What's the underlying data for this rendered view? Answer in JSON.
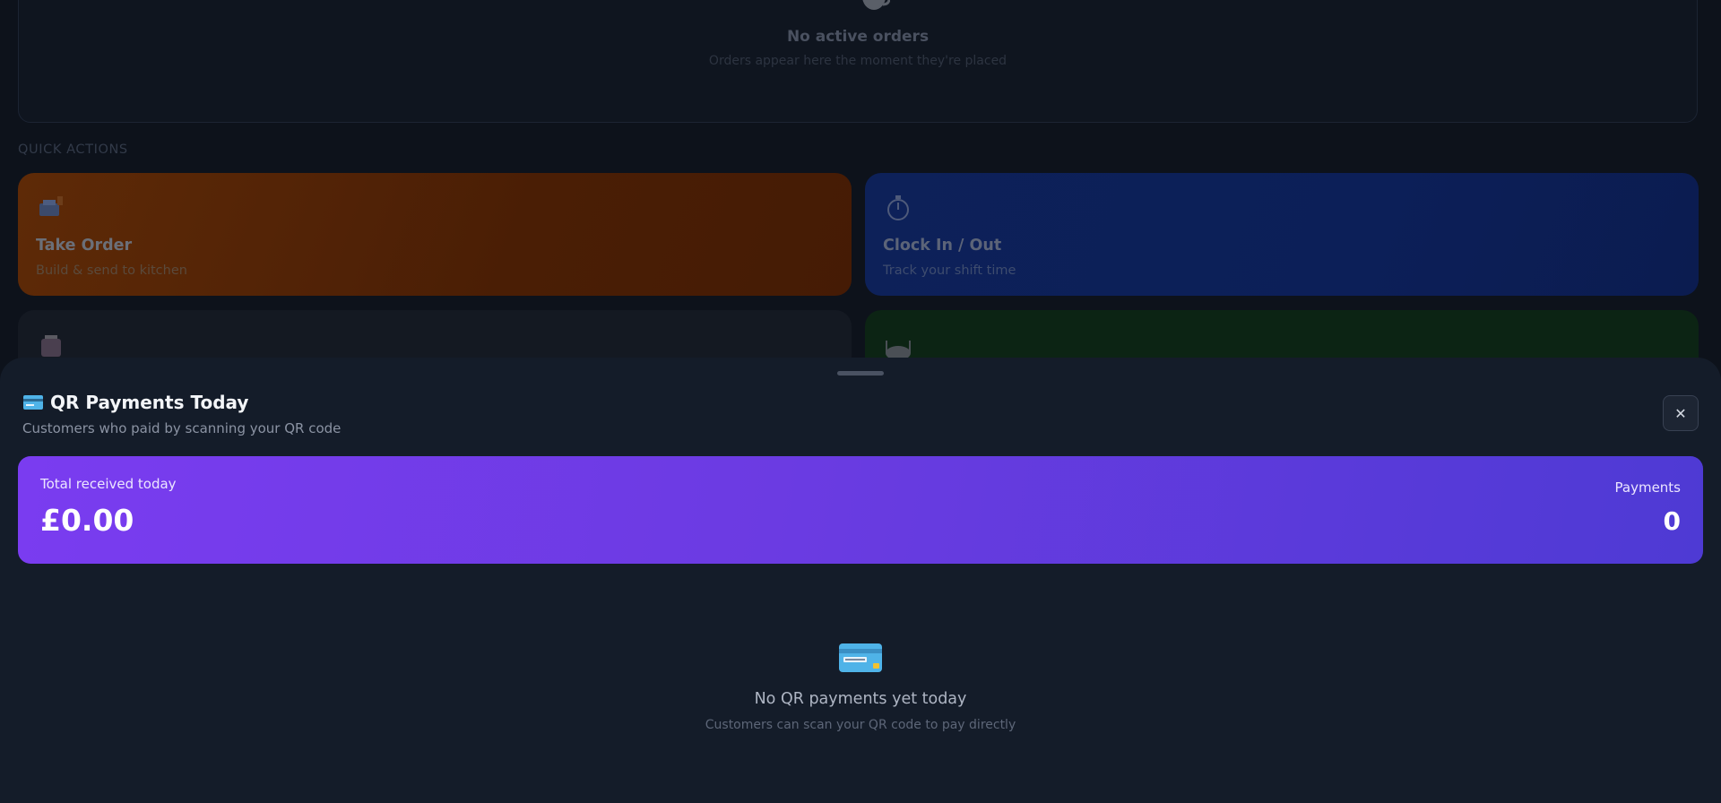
{
  "orders": {
    "icon": "coffee-icon",
    "empty_title": "No active orders",
    "empty_subtitle": "Orders appear here the moment they're placed"
  },
  "quick_actions": {
    "label": "QUICK ACTIONS",
    "items": [
      {
        "title": "Take Order",
        "subtitle": "Build & send to kitchen",
        "icon": "cash-register-icon",
        "color": "#c2410c"
      },
      {
        "title": "Clock In / Out",
        "subtitle": "Track your shift time",
        "icon": "stopwatch-icon",
        "color": "#1e3a8a"
      },
      {
        "title": "",
        "subtitle": "",
        "icon": "robot-icon",
        "color": "#1f2937"
      },
      {
        "title": "",
        "subtitle": "",
        "icon": "plate-icon",
        "color": "#14532d"
      }
    ]
  },
  "sheet": {
    "title_icon": "credit-card-icon",
    "title": "QR Payments Today",
    "subtitle": "Customers who paid by scanning your QR code",
    "close_label": "✕",
    "summary": {
      "total_label": "Total received today",
      "total_amount": "£0.00",
      "payments_label": "Payments",
      "payments_count": "0"
    },
    "empty": {
      "icon": "credit-card-icon",
      "title": "No QR payments yet today",
      "subtitle": "Customers can scan your QR code to pay directly"
    }
  },
  "colors": {
    "accent_start": "#7a3cf0",
    "accent_end": "#4e3ad4",
    "sheet_bg": "#141c29"
  }
}
